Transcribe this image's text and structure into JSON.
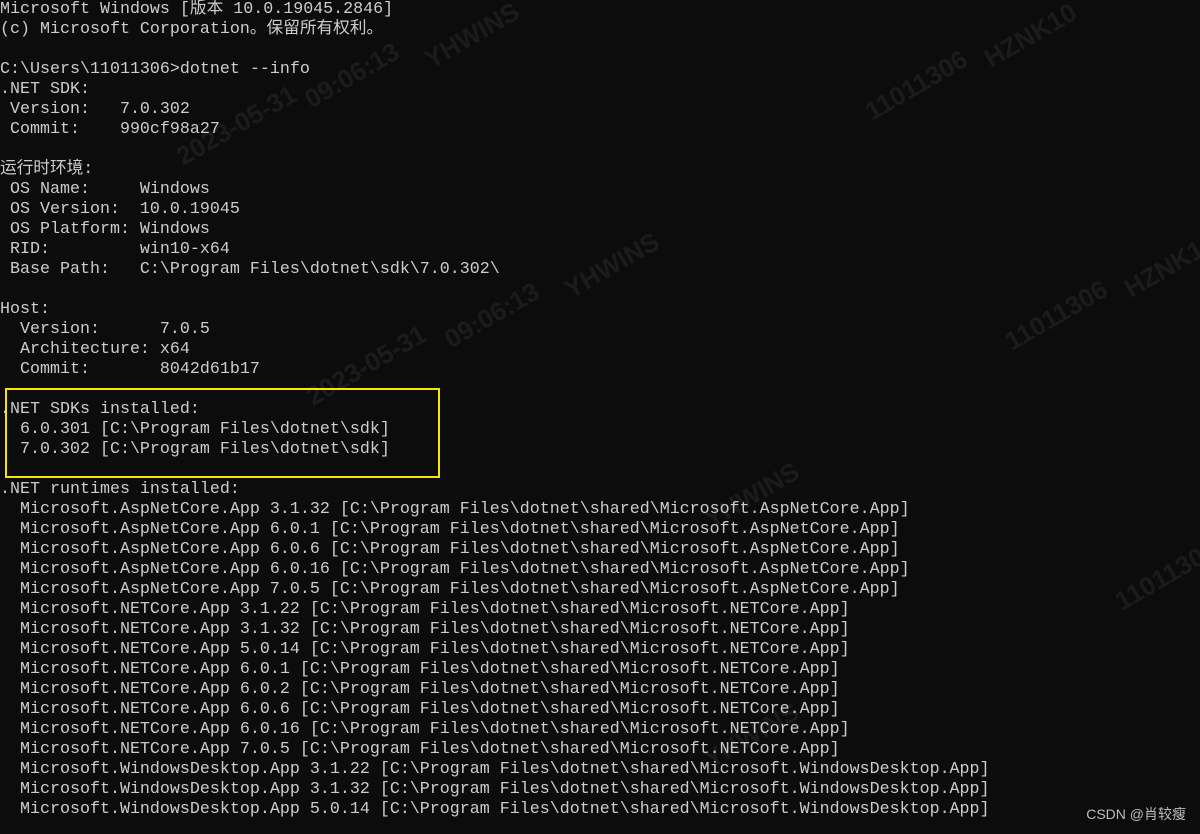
{
  "terminal": {
    "lines": [
      "Microsoft Windows [版本 10.0.19045.2846]",
      "(c) Microsoft Corporation。保留所有权利。",
      "",
      "C:\\Users\\11011306>dotnet --info",
      ".NET SDK:",
      " Version:   7.0.302",
      " Commit:    990cf98a27",
      "",
      "运行时环境:",
      " OS Name:     Windows",
      " OS Version:  10.0.19045",
      " OS Platform: Windows",
      " RID:         win10-x64",
      " Base Path:   C:\\Program Files\\dotnet\\sdk\\7.0.302\\",
      "",
      "Host:",
      "  Version:      7.0.5",
      "  Architecture: x64",
      "  Commit:       8042d61b17",
      "",
      ".NET SDKs installed:",
      "  6.0.301 [C:\\Program Files\\dotnet\\sdk]",
      "  7.0.302 [C:\\Program Files\\dotnet\\sdk]",
      "",
      ".NET runtimes installed:",
      "  Microsoft.AspNetCore.App 3.1.32 [C:\\Program Files\\dotnet\\shared\\Microsoft.AspNetCore.App]",
      "  Microsoft.AspNetCore.App 6.0.1 [C:\\Program Files\\dotnet\\shared\\Microsoft.AspNetCore.App]",
      "  Microsoft.AspNetCore.App 6.0.6 [C:\\Program Files\\dotnet\\shared\\Microsoft.AspNetCore.App]",
      "  Microsoft.AspNetCore.App 6.0.16 [C:\\Program Files\\dotnet\\shared\\Microsoft.AspNetCore.App]",
      "  Microsoft.AspNetCore.App 7.0.5 [C:\\Program Files\\dotnet\\shared\\Microsoft.AspNetCore.App]",
      "  Microsoft.NETCore.App 3.1.22 [C:\\Program Files\\dotnet\\shared\\Microsoft.NETCore.App]",
      "  Microsoft.NETCore.App 3.1.32 [C:\\Program Files\\dotnet\\shared\\Microsoft.NETCore.App]",
      "  Microsoft.NETCore.App 5.0.14 [C:\\Program Files\\dotnet\\shared\\Microsoft.NETCore.App]",
      "  Microsoft.NETCore.App 6.0.1 [C:\\Program Files\\dotnet\\shared\\Microsoft.NETCore.App]",
      "  Microsoft.NETCore.App 6.0.2 [C:\\Program Files\\dotnet\\shared\\Microsoft.NETCore.App]",
      "  Microsoft.NETCore.App 6.0.6 [C:\\Program Files\\dotnet\\shared\\Microsoft.NETCore.App]",
      "  Microsoft.NETCore.App 6.0.16 [C:\\Program Files\\dotnet\\shared\\Microsoft.NETCore.App]",
      "  Microsoft.NETCore.App 7.0.5 [C:\\Program Files\\dotnet\\shared\\Microsoft.NETCore.App]",
      "  Microsoft.WindowsDesktop.App 3.1.22 [C:\\Program Files\\dotnet\\shared\\Microsoft.WindowsDesktop.App]",
      "  Microsoft.WindowsDesktop.App 3.1.32 [C:\\Program Files\\dotnet\\shared\\Microsoft.WindowsDesktop.App]",
      "  Microsoft.WindowsDesktop.App 5.0.14 [C:\\Program Files\\dotnet\\shared\\Microsoft.WindowsDesktop.App]"
    ]
  },
  "colors": {
    "background": "#0c0c0c",
    "text": "#cccccc",
    "highlight_box": "#f7e600"
  },
  "watermark": [
    "YHWINS",
    "HZNK10",
    "11011306",
    "09:06:13",
    "2023-05-31"
  ],
  "credit": "CSDN @肖较瘦"
}
